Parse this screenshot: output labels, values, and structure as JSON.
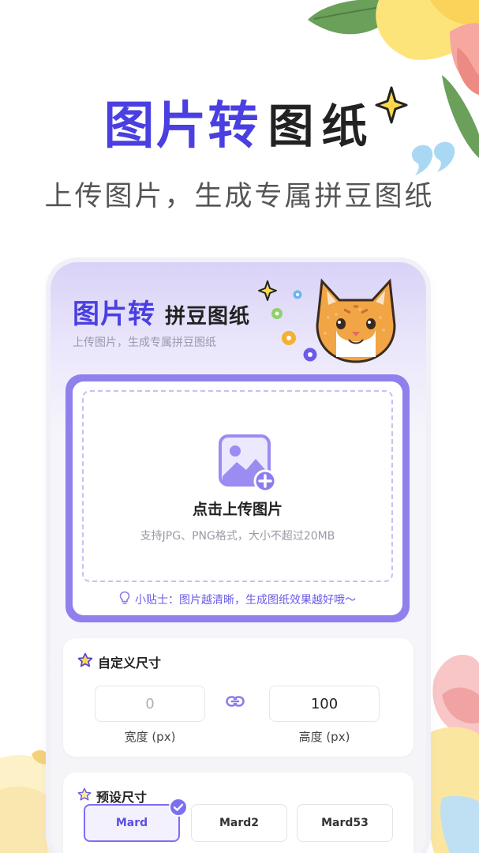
{
  "hero": {
    "title_part1": "图片转",
    "title_part2": "图纸",
    "subtitle": "上传图片，生成专属拼豆图纸"
  },
  "app": {
    "title_part1": "图片转",
    "title_part2": "拼豆图纸",
    "subtitle": "上传图片，生成专属拼豆图纸"
  },
  "upload": {
    "label": "点击上传图片",
    "hint": "支持JPG、PNG格式，大小不超过20MB",
    "tip": "小贴士：图片越清晰，生成图纸效果越好哦～"
  },
  "custom_size": {
    "title": "自定义尺寸",
    "width_value": "0",
    "height_value": "100",
    "width_label": "宽度 (px)",
    "height_label": "高度 (px)"
  },
  "preset_size": {
    "title": "预设尺寸",
    "options": [
      "Mard",
      "Mard2",
      "Mard53"
    ],
    "selected": "Mard"
  },
  "colors": {
    "accent": "#4a3fe0",
    "upload_border": "#8f80ee",
    "tip": "#6a5ce6"
  }
}
